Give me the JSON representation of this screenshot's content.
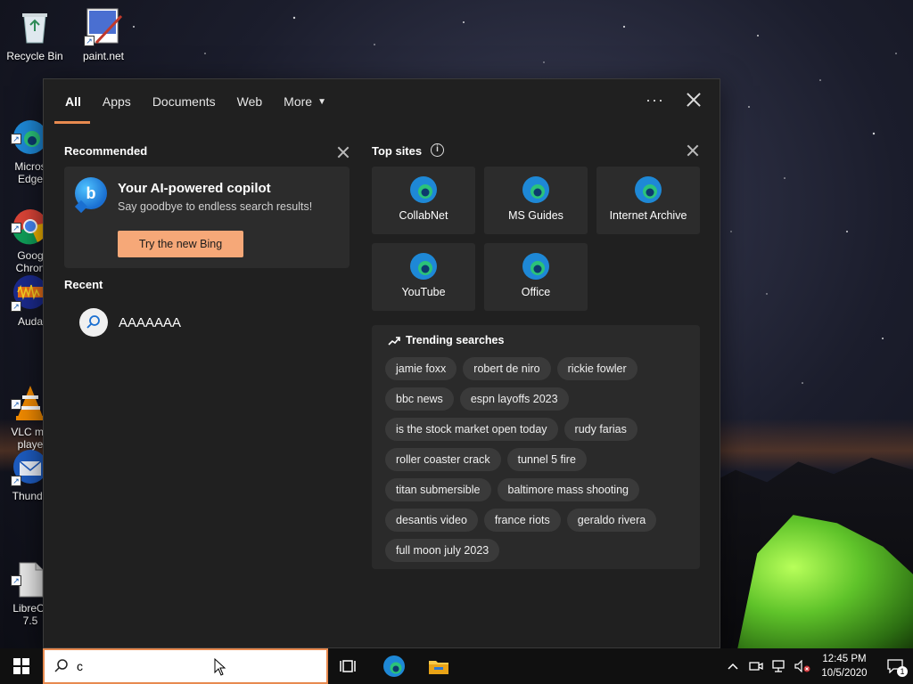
{
  "desktop": {
    "icons": [
      {
        "label": "Recycle Bin"
      },
      {
        "label": "paint.net"
      },
      {
        "label": "Micros\nEdge"
      },
      {
        "label": "Goog\nChron"
      },
      {
        "label": "Auda"
      },
      {
        "label": "VLC me\nplaye"
      },
      {
        "label": "Thunde"
      },
      {
        "label": "LibreOf\n7.5"
      }
    ]
  },
  "panel": {
    "tabs": [
      {
        "label": "All"
      },
      {
        "label": "Apps"
      },
      {
        "label": "Documents"
      },
      {
        "label": "Web"
      },
      {
        "label": "More"
      }
    ],
    "recommended": {
      "title": "Recommended",
      "card_title": "Your AI-powered copilot",
      "card_subtitle": "Say goodbye to endless search results!",
      "button_label": "Try the new Bing",
      "logo_letter": "b"
    },
    "recent": {
      "title": "Recent",
      "items": [
        {
          "label": "AAAAAAA"
        }
      ]
    },
    "top_sites": {
      "title": "Top sites",
      "info_glyph": "i",
      "sites": [
        {
          "label": "CollabNet"
        },
        {
          "label": "MS Guides"
        },
        {
          "label": "Internet Archive"
        },
        {
          "label": "YouTube"
        },
        {
          "label": "Office"
        }
      ]
    },
    "trending": {
      "title": "Trending searches",
      "items": [
        "jamie foxx",
        "robert de niro",
        "rickie fowler",
        "bbc news",
        "espn layoffs 2023",
        "is the stock market open today",
        "rudy farias",
        "roller coaster crack",
        "tunnel 5 fire",
        "titan submersible",
        "baltimore mass shooting",
        "desantis video",
        "france riots",
        "geraldo rivera",
        "full moon july 2023"
      ]
    }
  },
  "taskbar": {
    "search_value": "c",
    "time": "12:45 PM",
    "date": "10/5/2020",
    "notification_count": "1"
  },
  "colors": {
    "accent": "#e88a4f",
    "panel_bg": "#202020",
    "button_bg": "#f6a878"
  }
}
